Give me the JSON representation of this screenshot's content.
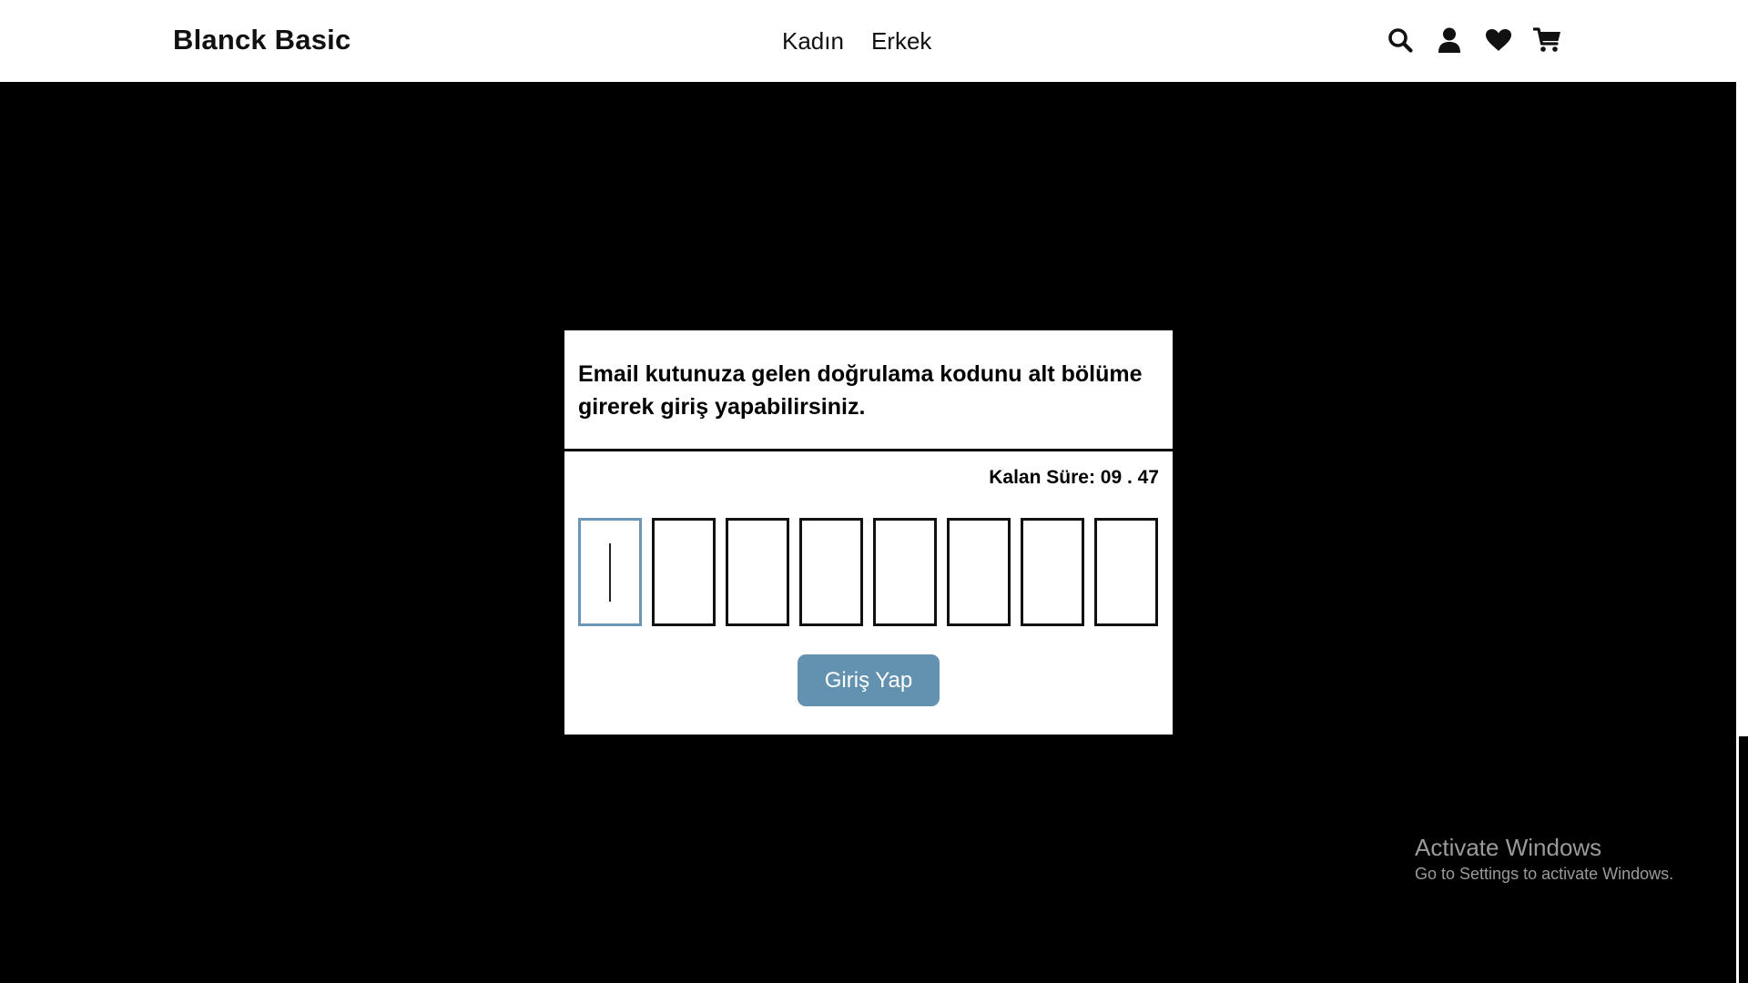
{
  "header": {
    "brand": "Blanck Basic",
    "nav": [
      "Kadın",
      "Erkek"
    ],
    "icons": [
      "search-icon",
      "user-icon",
      "heart-icon",
      "cart-icon"
    ]
  },
  "modal": {
    "message": "Email kutunuza gelen doğrulama kodunu alt bölüme girerek giriş yapabilirsiniz.",
    "timer_label": "Kalan Süre: 09 . 47",
    "code_length": 8,
    "code_values": [
      "",
      "",
      "",
      "",
      "",
      "",
      "",
      ""
    ],
    "submit_label": "Giriş Yap"
  },
  "watermark": {
    "title": "Activate Windows",
    "subtitle": "Go to Settings to activate Windows."
  },
  "colors": {
    "accent_button": "#6392b1",
    "active_input_border": "#6b96b8",
    "backdrop": "#000000"
  }
}
